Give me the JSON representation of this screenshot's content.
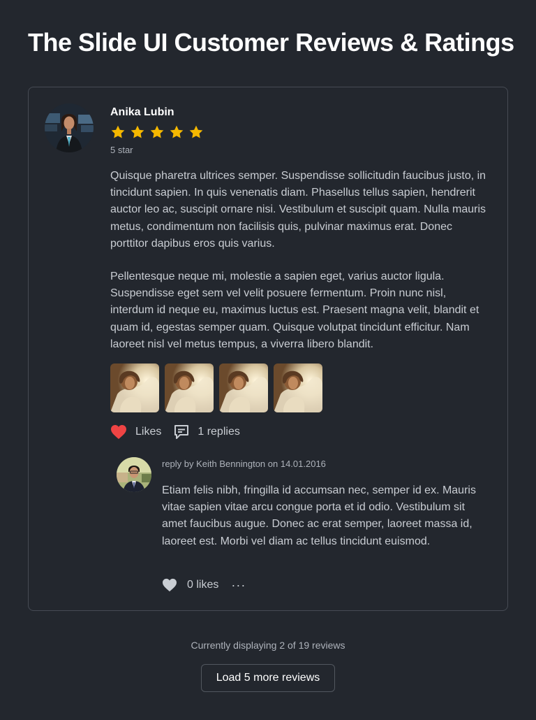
{
  "page": {
    "title": "The Slide UI Customer Reviews & Ratings"
  },
  "review": {
    "author": "Anika Lubin",
    "rating": 5,
    "max_rating": 5,
    "rating_label": "5 star",
    "paragraphs": [
      "Quisque pharetra ultrices semper. Suspendisse sollicitudin faucibus justo, in tincidunt sapien. In quis venenatis diam. Phasellus tellus sapien, hendrerit auctor leo ac, suscipit ornare nisi. Vestibulum et suscipit quam. Nulla mauris metus, condimentum non facilisis quis, pulvinar maximus erat. Donec porttitor dapibus eros quis varius.",
      "Pellentesque neque mi, molestie a sapien eget, varius auctor ligula. Suspendisse eget sem vel velit posuere fermentum. Proin nunc nisl, interdum id neque eu, maximus luctus est. Praesent magna velit, blandit et quam id, egestas semper quam. Quisque volutpat tincidunt efficitur. Nam laoreet nisl vel metus tempus, a viverra libero blandit."
    ],
    "photos_count": 4,
    "likes_label": "Likes",
    "replies_label": "1 replies",
    "icons": {
      "like": "heart-icon",
      "replies": "comment-icon",
      "star": "star-icon"
    },
    "colors": {
      "star": "#f5b800",
      "heart_active": "#ef4444",
      "heart_inactive": "#c9cdd3"
    }
  },
  "reply": {
    "meta": "reply by Keith Bennington on 14.01.2016",
    "text": "Etiam felis nibh, fringilla id accumsan nec, semper id ex. Mauris vitae sapien vitae arcu congue porta et id odio. Vestibulum sit amet faucibus augue. Donec ac erat semper, laoreet massa id, laoreet est. Morbi vel diam ac tellus tincidunt euismod.",
    "likes_label": "0 likes",
    "more_label": "···"
  },
  "footer": {
    "count_text": "Currently displaying 2 of 19 reviews",
    "load_more_label": "Load 5 more reviews"
  }
}
